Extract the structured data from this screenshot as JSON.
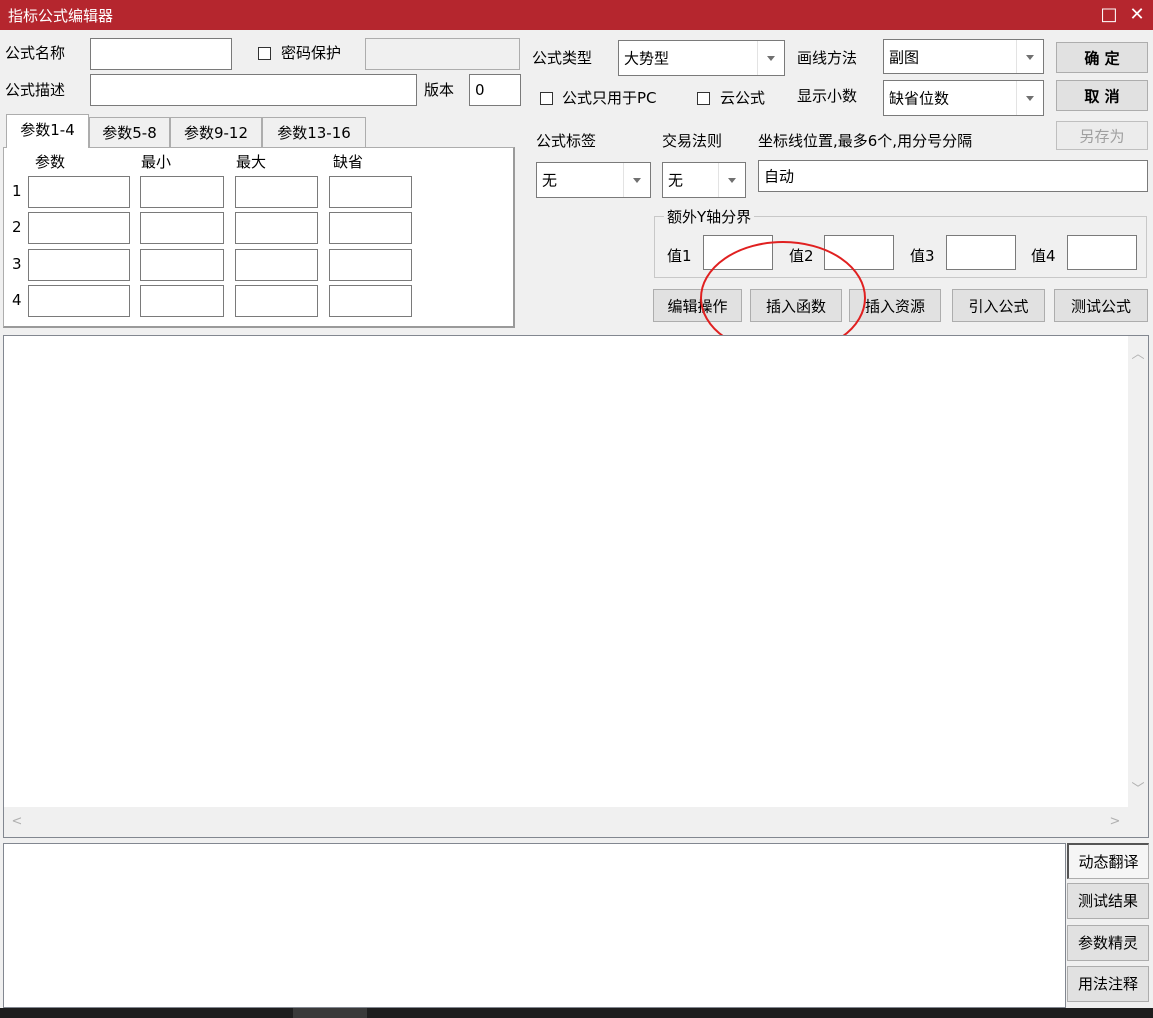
{
  "window": {
    "title": "指标公式编辑器",
    "maximize_glyph": "□",
    "close_glyph": "✕"
  },
  "formula": {
    "name_label": "公式名称",
    "name_value": "",
    "password_label": "密码保护",
    "password_value": "",
    "desc_label": "公式描述",
    "desc_value": "",
    "version_label": "版本",
    "version_value": "0",
    "type_label": "公式类型",
    "type_value": "大势型",
    "draw_label": "画线方法",
    "draw_value": "副图",
    "pc_only_label": "公式只用于PC",
    "cloud_label": "云公式",
    "decimal_label": "显示小数",
    "decimal_value": "缺省位数",
    "tag_label": "公式标签",
    "tag_value": "无",
    "rule_label": "交易法则",
    "rule_value": "无",
    "axis_label": "坐标线位置,最多6个,用分号分隔",
    "axis_value": "自动"
  },
  "buttons": {
    "ok": "确 定",
    "cancel": "取 消",
    "save_as": "另存为"
  },
  "params": {
    "tabs": [
      "参数1-4",
      "参数5-8",
      "参数9-12",
      "参数13-16"
    ],
    "headers": [
      "参数",
      "最小",
      "最大",
      "缺省"
    ],
    "rows": [
      "1",
      "2",
      "3",
      "4"
    ]
  },
  "y_axis": {
    "group_label": "额外Y轴分界",
    "labels": [
      "值1",
      "值2",
      "值3",
      "值4"
    ],
    "values": [
      "",
      "",
      "",
      ""
    ]
  },
  "toolbar": {
    "edit_ops": "编辑操作",
    "insert_func": "插入函数",
    "insert_res": "插入资源",
    "import_formula": "引入公式",
    "test_formula": "测试公式"
  },
  "side_buttons": {
    "dynamic_translate": "动态翻译",
    "test_result": "测试结果",
    "param_wizard": "参数精灵",
    "usage_notes": "用法注释"
  },
  "editor": {
    "content": ""
  },
  "output": {
    "content": ""
  },
  "colors": {
    "titlebar": "#b5262e",
    "annotation": "#e02020",
    "background": "#f0f0f0"
  }
}
